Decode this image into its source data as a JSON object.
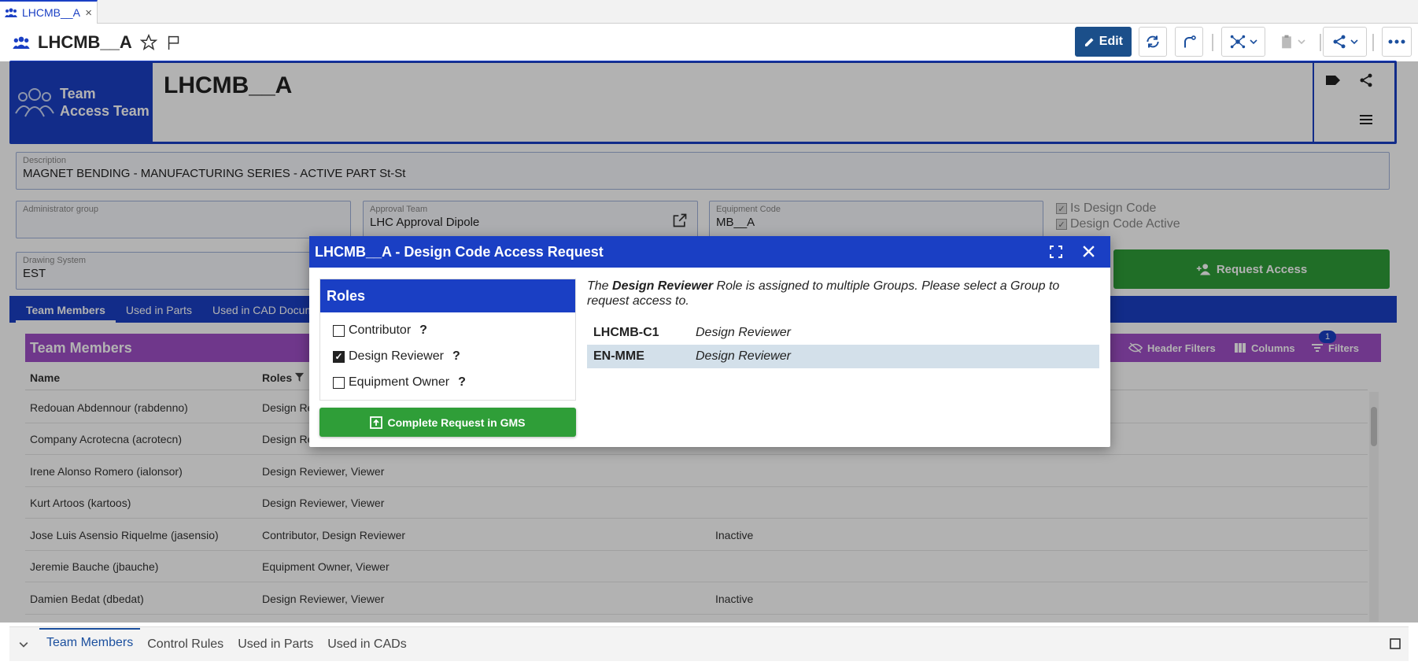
{
  "tab": {
    "label": "LHCMB__A",
    "close": "×"
  },
  "header": {
    "title": "LHCMB__A",
    "edit_label": "Edit"
  },
  "card": {
    "type_line1": "Team",
    "type_line2": "Access Team",
    "name": "LHCMB__A"
  },
  "form": {
    "description": {
      "label": "Description",
      "value": "MAGNET BENDING - MANUFACTURING SERIES - ACTIVE PART St-St"
    },
    "admin_group": {
      "label": "Administrator group",
      "value": ""
    },
    "approval_team": {
      "label": "Approval Team",
      "value": "LHC Approval Dipole"
    },
    "equipment_code": {
      "label": "Equipment Code",
      "value": "MB__A"
    },
    "is_design_code": "Is Design Code",
    "design_code_active": "Design Code Active",
    "drawing_system": {
      "label": "Drawing System",
      "value": "EST"
    },
    "request_access": "Request Access"
  },
  "subtabs": [
    "Team Members",
    "Used in Parts",
    "Used in CAD Docum"
  ],
  "panel": {
    "title": "Team Members",
    "tool_header_filters": "Header Filters",
    "tool_columns": "Columns",
    "tool_filters": "Filters",
    "filter_count": "1",
    "col_name": "Name",
    "col_roles": "Roles"
  },
  "rows": [
    {
      "name": "Redouan Abdennour (rabdenno)",
      "roles": "Design Re",
      "status": ""
    },
    {
      "name": "Company Acrotecna (acrotecn)",
      "roles": "Design Re",
      "status": ""
    },
    {
      "name": "Irene Alonso Romero (ialonsor)",
      "roles": "Design Reviewer, Viewer",
      "status": ""
    },
    {
      "name": "Kurt Artoos (kartoos)",
      "roles": "Design Reviewer, Viewer",
      "status": ""
    },
    {
      "name": "Jose Luis Asensio Riquelme (jasensio)",
      "roles": "Contributor, Design Reviewer",
      "status": "Inactive"
    },
    {
      "name": "Jeremie Bauche (jbauche)",
      "roles": "Equipment Owner, Viewer",
      "status": ""
    },
    {
      "name": "Damien Bedat (dbedat)",
      "roles": "Design Reviewer, Viewer",
      "status": "Inactive"
    }
  ],
  "bottom_tabs": [
    "Team Members",
    "Control Rules",
    "Used in Parts",
    "Used in CADs"
  ],
  "modal": {
    "title": "LHCMB__A - Design Code Access Request",
    "roles_title": "Roles",
    "roles": [
      {
        "label": "Contributor",
        "checked": false
      },
      {
        "label": "Design Reviewer",
        "checked": true
      },
      {
        "label": "Equipment Owner",
        "checked": false
      }
    ],
    "help": "?",
    "msg_pre": "The ",
    "msg_role": "Design Reviewer",
    "msg_post": " Role is assigned to multiple Groups. Please select a Group to request access to.",
    "groups": [
      {
        "group": "LHCMB-C1",
        "role": "Design Reviewer",
        "selected": false
      },
      {
        "group": "EN-MME",
        "role": "Design Reviewer",
        "selected": true
      }
    ],
    "complete_btn": "Complete Request in GMS"
  },
  "colors": {
    "brand": "#1a3fc4",
    "green": "#2f9e38",
    "panel": "#a050c8"
  }
}
